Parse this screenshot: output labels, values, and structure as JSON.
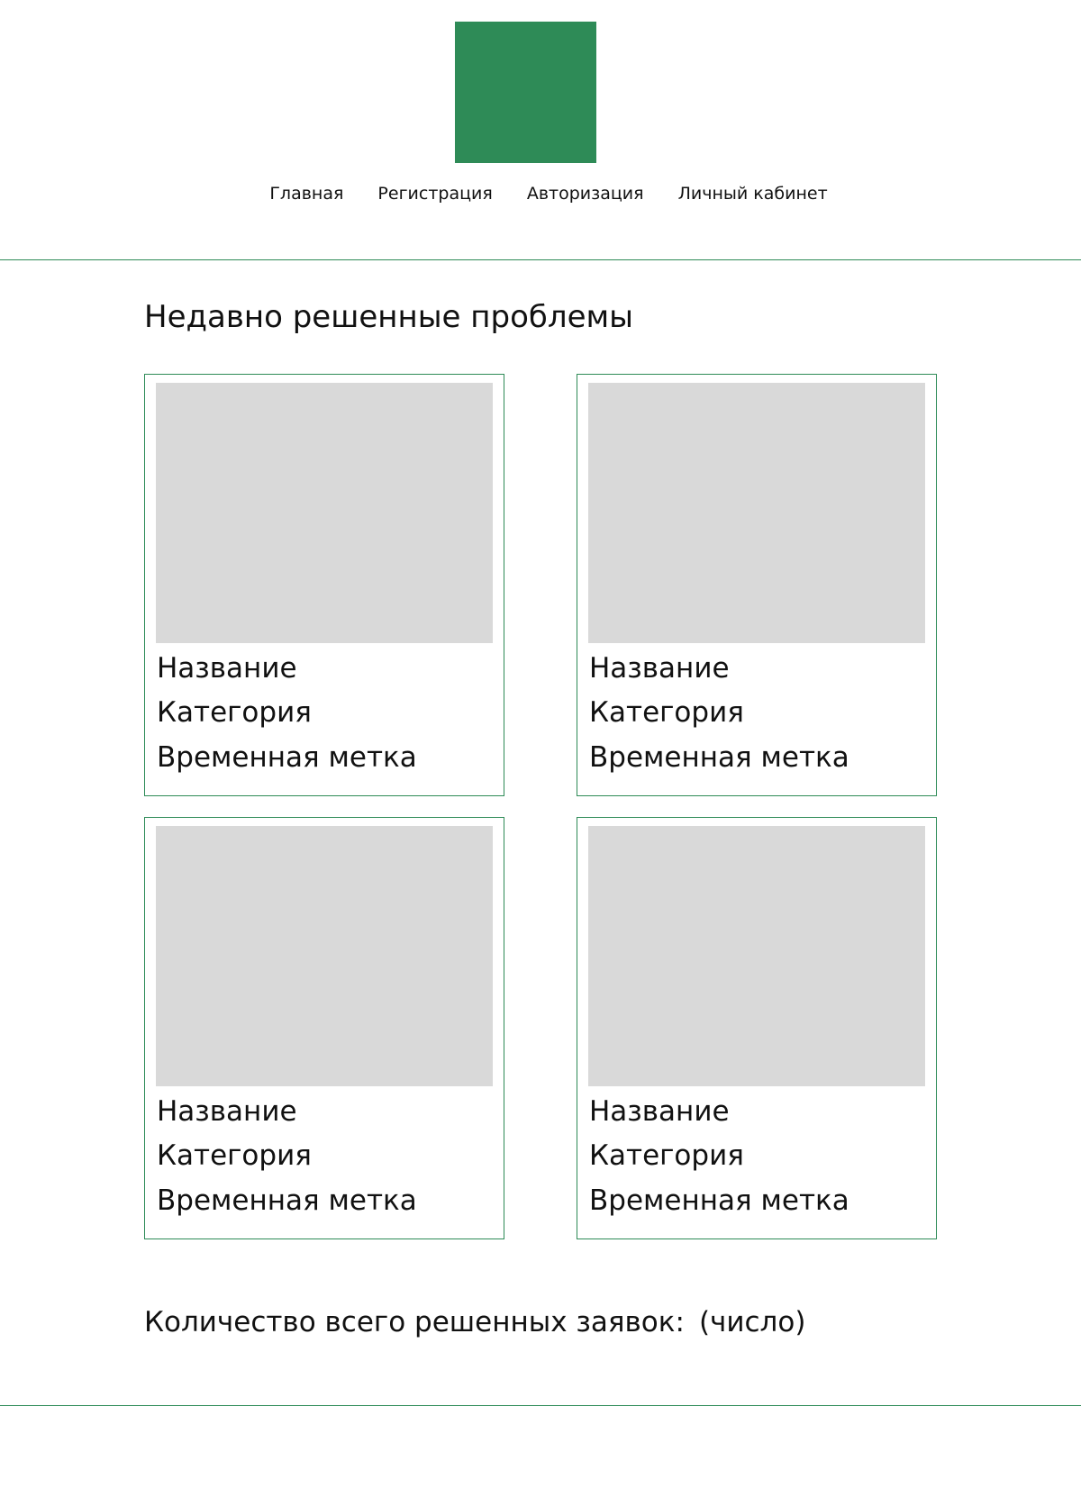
{
  "header": {
    "nav": [
      {
        "label": "Главная"
      },
      {
        "label": "Регистрация"
      },
      {
        "label": "Авторизация"
      },
      {
        "label": "Личный кабинет"
      }
    ]
  },
  "main": {
    "section_title": "Недавно решенные проблемы",
    "cards": [
      {
        "title": "Название",
        "category": "Категория",
        "timestamp": "Временная метка"
      },
      {
        "title": "Название",
        "category": "Категория",
        "timestamp": "Временная метка"
      },
      {
        "title": "Название",
        "category": "Категория",
        "timestamp": "Временная метка"
      },
      {
        "title": "Название",
        "category": "Категория",
        "timestamp": "Временная метка"
      }
    ],
    "total_label": "Количество всего решенных заявок:",
    "total_value": "(число)"
  },
  "colors": {
    "accent": "#2e8b57",
    "placeholder": "#d9d9d9",
    "text": "#111111"
  }
}
